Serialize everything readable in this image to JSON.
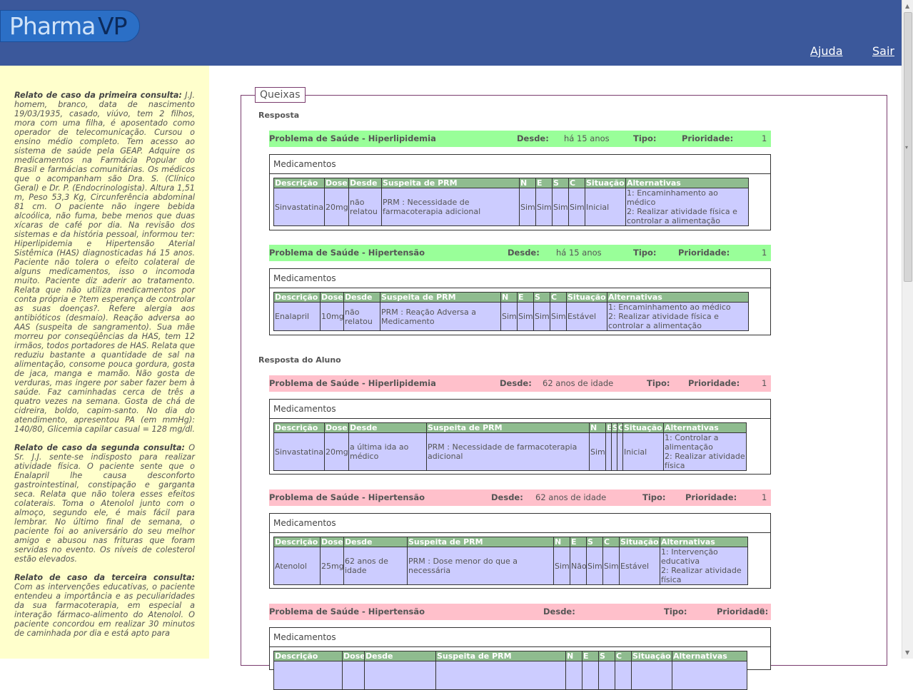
{
  "header": {
    "logo_part1": "Pharma",
    "logo_part2": "VP",
    "help": "Ajuda",
    "logout": "Sair"
  },
  "sidebar": {
    "case1_title": "Relato de caso da primeira consulta:",
    "case1_text": "J.J. homem, branco, data de nascimento 19/03/1935, casado, viúvo, tem 2 filhos, mora com uma filha, é aposentado como operador de telecomunicação. Cursou o ensino médio completo. Tem acesso ao sistema de saúde pela GEAP. Adquire os medicamentos na Farmácia Popular do Brasil e farmácias comunitárias. Os médicos que o acompanham são Dra. S. (Clínico Geral) e Dr. P. (Endocrinologista). Altura 1,51 m, Peso 53,3 Kg, Circunferência abdominal 81 cm. O paciente não ingere bebida alcoólica, não fuma, bebe menos que duas xícaras de café por dia. Na revisão dos sistemas e da história pessoal, informou ter: Hiperlipidemia e Hipertensão Aterial Sistêmica (HAS) diagnosticadas há 15 anos. Paciente não tolera o efeito colateral de alguns medicamentos, isso o incomoda muito. Paciente diz aderir ao tratamento. Relata que não utiliza medicamentos por conta própria e ?tem esperança de controlar as suas doenças?. Refere alergia aos antibióticos (desmaio). Reação adversa ao AAS (suspeita de sangramento). Sua mãe morreu por conseqüências da HAS, tem 12 irmãos, todos portadores de HAS. Relata que reduziu bastante a quantidade de sal na alimentação, consome pouca gordura, gosta de jaca, manga e mamão. Não gosta de verduras, mas ingere por saber fazer bem à saúde. Faz caminhadas cerca de três a quatro vezes na semana. Gosta de chá de cidreira, boldo, capim-santo. No dia do atendimento, apresentou PA (em mmHg): 140/80, Glicemia capilar casual = 128 mg/dl.",
    "case2_title": "Relato de caso da segunda consulta:",
    "case2_text": "O Sr. J.J. sente-se indisposto para realizar atividade física. O paciente sente que o Enalapril lhe causa desconforto gastrointestinal, constipação e garganta seca. Relata que não tolera esses efeitos colaterais. Toma o Atenolol junto com o almoço, segundo ele, é mais fácil para lembrar. No último final de semana, o paciente foi ao aniversário do seu melhor amigo e abusou nas frituras que foram servidas no evento. Os níveis de colesterol estão elevados.",
    "case3_title": "Relato de caso da terceira consulta:",
    "case3_text": "Com as intervenções educativas, o paciente entendeu a importância e as peculiaridades da sua farmacoterapia, em especial a interação fármaco-alimento do Atenolol. O paciente concordou em realizar 30 minutos de caminhada por dia e está apto para"
  },
  "main": {
    "legend": "Queixas",
    "answer_label": "Resposta",
    "student_label": "Resposta do Aluno",
    "labels": {
      "since": "Desde:",
      "type": "Tipo:",
      "priority": "Prioridade:",
      "medications": "Medicamentos"
    },
    "columns": [
      "Descrição",
      "Dose",
      "Desde",
      "Suspeita de PRM",
      "N",
      "E",
      "S",
      "C",
      "Situação",
      "Alternativas"
    ],
    "problems": [
      {
        "title": "Problema de Saúde - Hiperlipidemia",
        "since": "há 15 anos",
        "type": "",
        "priority": "1",
        "row": [
          "Sinvastatina",
          "20mg",
          "não relatou",
          "PRM : Necessidade de farmacoterapia adicional",
          "Sim",
          "Sim",
          "Sim",
          "Sim",
          "Inicial",
          "1: Encaminhamento ao médico\n2: Realizar atividade física e controlar a alimentação"
        ]
      },
      {
        "title": "Problema de Saúde - Hipertensão",
        "since": "há 15 anos",
        "type": "",
        "priority": "1",
        "row": [
          "Enalapril",
          "10mg",
          "não relatou",
          "PRM : Reação Adversa a Medicamento",
          "Sim",
          "Sim",
          "Sim",
          "Sim",
          "Estável",
          "1: Encaminhamento ao médico\n2: Realizar atividade física e controlar a alimentação"
        ]
      },
      {
        "title": "Problema de Saúde - Hiperlipidemia",
        "since": "62 anos de idade",
        "type": "",
        "priority": "1",
        "row": [
          "Sinvastatina",
          "20mg",
          "a última ida ao médico",
          "PRM : Necessidade de farmacoterapia adicional",
          "Sim",
          "",
          "",
          "",
          "Inicial",
          "1: Controlar a alimentação\n2: Realizar atividade física"
        ]
      },
      {
        "title": "Problema de Saúde - Hipertensão",
        "since": "62 anos de idade",
        "type": "",
        "priority": "1",
        "row": [
          "Atenolol",
          "25mg",
          "62 anos de idade",
          "PRM : Dose menor do que a necessária",
          "Sim",
          "Não",
          "Sim",
          "Sim",
          "Estável",
          "1: Intervenção educativa\n2: Realizar atividade física"
        ]
      },
      {
        "title": "Problema de Saúde - Hipertensão",
        "since": "",
        "type": "",
        "priority": "0",
        "row": [
          "",
          "",
          "",
          "",
          "",
          "",
          "",
          "",
          "",
          ""
        ]
      }
    ]
  }
}
